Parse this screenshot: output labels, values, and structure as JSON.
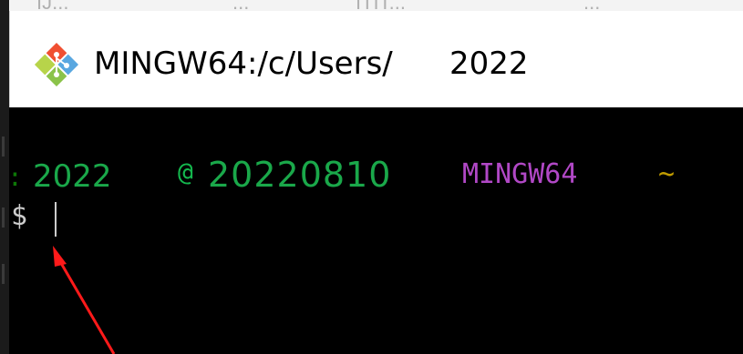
{
  "background": {
    "fragments": [
      "IJ...",
      "...",
      "ITIT...",
      "..."
    ]
  },
  "window": {
    "title_path": "MINGW64:/c/Users/",
    "title_suffix": "2022",
    "icon": "git-bash-diamond-icon"
  },
  "terminal": {
    "prompt": {
      "user": "2022",
      "at": "@",
      "host": "20220810",
      "env": "MINGW64",
      "cwd": "~"
    },
    "input": {
      "symbol": "$",
      "value": ""
    }
  },
  "annotation": {
    "icon": "red-arrow-pointer",
    "color": "#ff1a1a"
  },
  "colors": {
    "user_green": "#1aa84a",
    "env_magenta": "#b148c6",
    "cwd_yellow": "#c19c00",
    "text_grey": "#cccccc"
  }
}
